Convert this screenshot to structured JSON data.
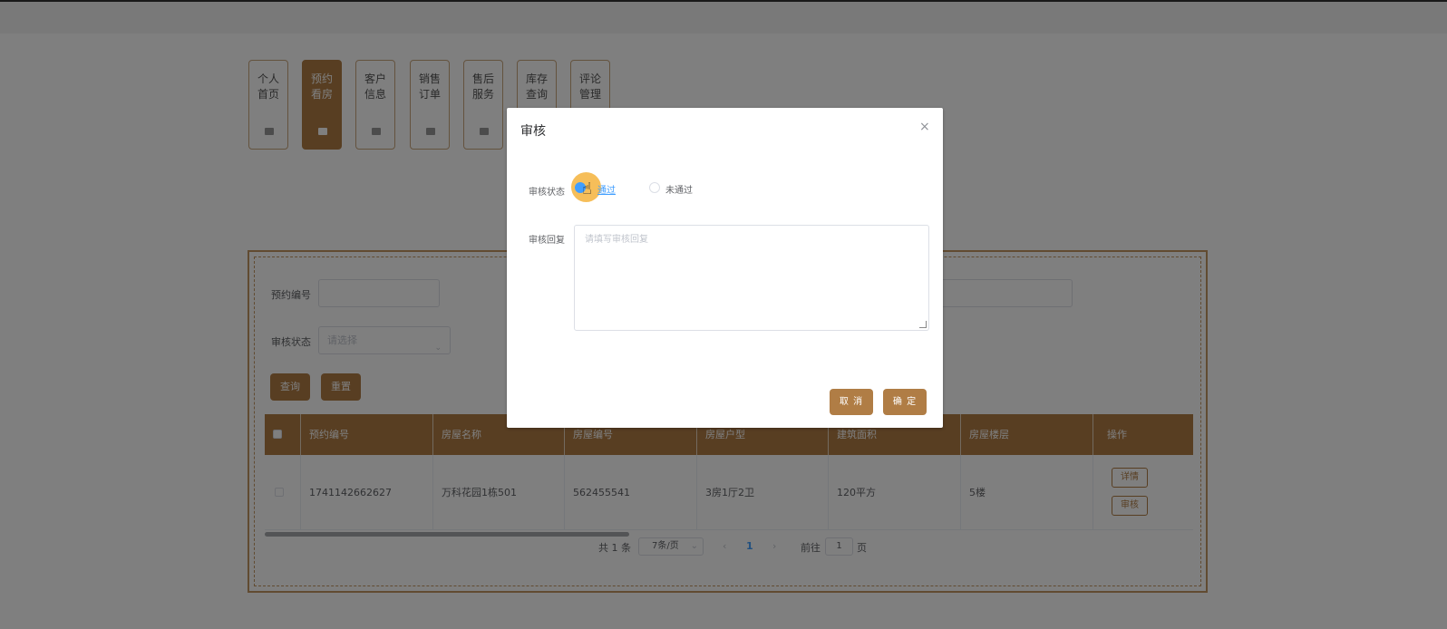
{
  "nav": {
    "items": [
      {
        "label": "个人首页"
      },
      {
        "label": "预约看房"
      },
      {
        "label": "客户信息"
      },
      {
        "label": "销售订单"
      },
      {
        "label": "售后服务"
      },
      {
        "label": "库存查询"
      },
      {
        "label": "评论管理"
      }
    ],
    "active_index": 1
  },
  "search": {
    "order_no_label": "预约编号",
    "order_no_value": "",
    "status_label": "审核状态",
    "status_placeholder": "请选择",
    "query_button": "查询",
    "reset_button": "重置"
  },
  "table": {
    "headers": [
      "预约编号",
      "房屋名称",
      "房屋编号",
      "房屋户型",
      "建筑面积",
      "房屋楼层",
      "操作"
    ],
    "rows": [
      {
        "order_no": "1741142662627",
        "house_name": "万科花园1栋501",
        "house_no": "562455541",
        "layout": "3房1厅2卫",
        "area": "120平方",
        "floor": "5楼",
        "detail_button": "详情",
        "review_button": "审核"
      }
    ]
  },
  "pagination": {
    "total": "共 1 条",
    "page_size": "7条/页",
    "current_page": "1",
    "goto_label": "前往",
    "goto_value": "1",
    "page_suffix": "页"
  },
  "dialog": {
    "title": "审核",
    "close_icon": "×",
    "status_label": "审核状态",
    "option_pass": "通过",
    "option_fail": "未通过",
    "reply_label": "审核回复",
    "reply_placeholder": "请填写审核回复",
    "cancel_button": "取 消",
    "confirm_button": "确 定"
  },
  "colors": {
    "brand": "#b07d45",
    "link": "#409eff",
    "highlight": "#f5b33c"
  }
}
